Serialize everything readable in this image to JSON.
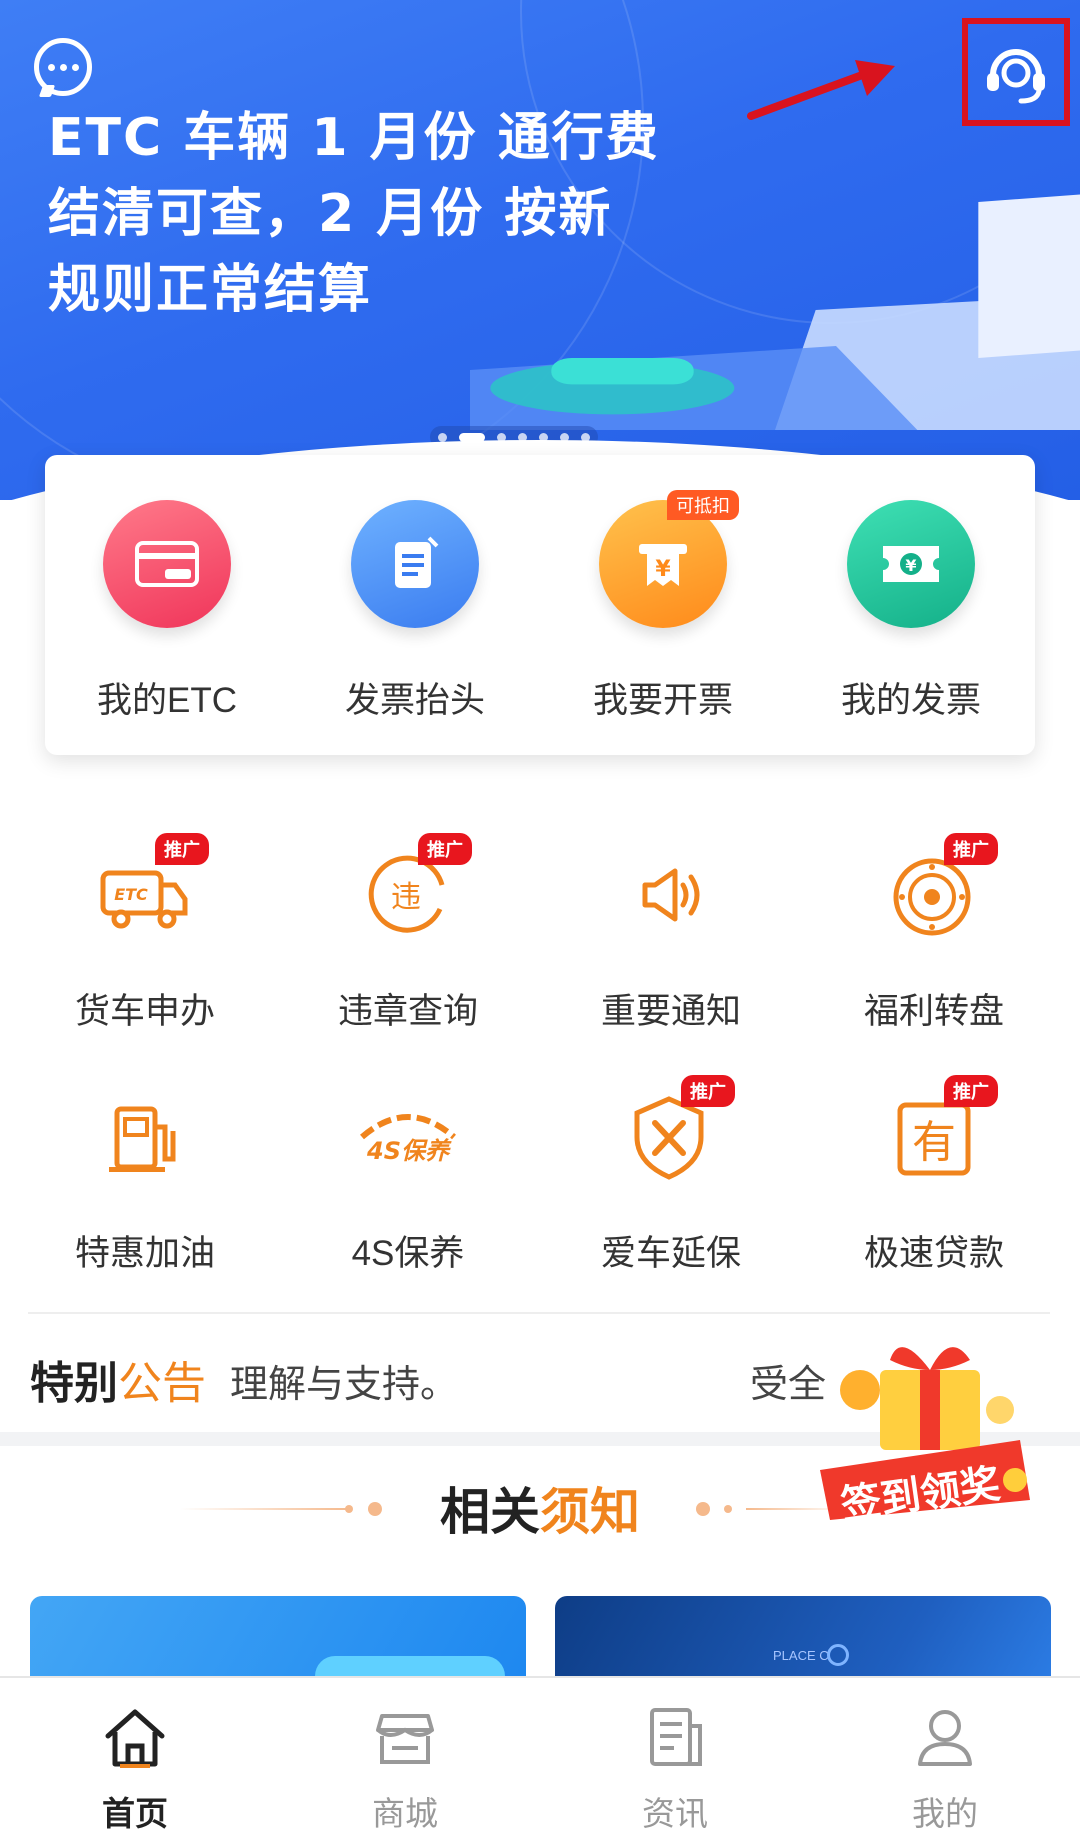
{
  "banner": {
    "title_line1": "ETC 车辆 1 月份 通行费",
    "title_line2": "结清可查，2 月份 按新",
    "title_line3": "规则正常结算",
    "total_slides": 7,
    "active_slide": 2
  },
  "quick_actions": [
    {
      "label": "我的ETC",
      "icon": "etc-card-icon"
    },
    {
      "label": "发票抬头",
      "icon": "document-edit-icon"
    },
    {
      "label": "我要开票",
      "icon": "receipt-icon",
      "tag": "可抵扣"
    },
    {
      "label": "我的发票",
      "icon": "invoice-ticket-icon"
    }
  ],
  "services": [
    {
      "label": "货车申办",
      "icon": "etc-truck-icon",
      "tag": "推广"
    },
    {
      "label": "违章查询",
      "icon": "violation-icon",
      "tag": "推广",
      "glyph": "违"
    },
    {
      "label": "重要通知",
      "icon": "speaker-icon"
    },
    {
      "label": "福利转盘",
      "icon": "lucky-wheel-icon",
      "tag": "推广"
    },
    {
      "label": "特惠加油",
      "icon": "fuel-pump-icon"
    },
    {
      "label": "4S保养",
      "icon": "4s-maintenance-icon",
      "glyph": "4S保养"
    },
    {
      "label": "爱车延保",
      "icon": "shield-wrench-icon",
      "tag": "推广"
    },
    {
      "label": "极速贷款",
      "icon": "loan-icon",
      "tag": "推广",
      "glyph": "有"
    }
  ],
  "notice": {
    "title_main": "特别",
    "title_accent": "公告",
    "text": "理解与支持。",
    "text2": "受全"
  },
  "related": {
    "title_main": "相关",
    "title_accent": "须知"
  },
  "reward_badge": {
    "label": "签到领奖"
  },
  "news_cards": [
    {
      "caption": ""
    },
    {
      "caption": "PLACE C"
    }
  ],
  "tabbar": [
    {
      "label": "首页",
      "icon": "home-icon",
      "active": true
    },
    {
      "label": "商城",
      "icon": "store-icon",
      "active": false
    },
    {
      "label": "资讯",
      "icon": "news-icon",
      "active": false
    },
    {
      "label": "我的",
      "icon": "profile-icon",
      "active": false
    }
  ],
  "colors": {
    "banner_blue": "#2f6bef",
    "accent_orange": "#f0841d",
    "promo_red": "#e8161e",
    "annotation_red": "#d9131e"
  }
}
